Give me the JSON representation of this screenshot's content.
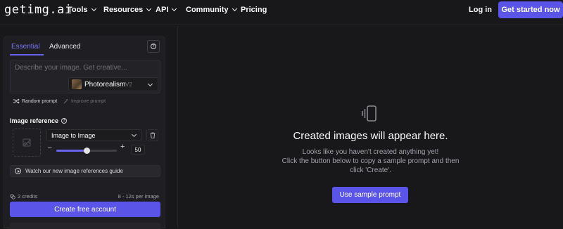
{
  "nav": {
    "logo": "getimg.ai",
    "items": [
      {
        "label": "Tools",
        "has_dropdown": true
      },
      {
        "label": "Resources",
        "has_dropdown": true
      },
      {
        "label": "API",
        "has_dropdown": true
      },
      {
        "label": "Community",
        "has_dropdown": true
      },
      {
        "label": "Pricing",
        "has_dropdown": false
      }
    ],
    "login_label": "Log in",
    "cta_label": "Get started now"
  },
  "panel": {
    "tabs": [
      {
        "label": "Essential",
        "active": true
      },
      {
        "label": "Advanced",
        "active": false
      }
    ],
    "prompt_placeholder": "Describe your image. Get creative...",
    "prompt_value": "",
    "style": {
      "name": "Photorealism",
      "version": "V2"
    },
    "random_prompt_label": "Random prompt",
    "improve_prompt_label": "Improve prompt",
    "image_reference": {
      "title": "Image reference",
      "mode": "Image to Image",
      "strength": 50
    },
    "guide_label": "Watch our new image references guide",
    "credits_label": "2 credits",
    "time_label": "8 - 12s per image",
    "create_label": "Create free account"
  },
  "empty_state": {
    "title": "Created images will appear here.",
    "line1": "Looks like you haven't created anything yet!",
    "line2": "Click the button below to copy a sample prompt and then",
    "line3": "click 'Create'.",
    "button_label": "Use sample prompt"
  },
  "colors": {
    "background": "#18181b",
    "panel": "#1f1f23",
    "accent": "#5b54e8",
    "active_tab": "#7c76f5"
  }
}
